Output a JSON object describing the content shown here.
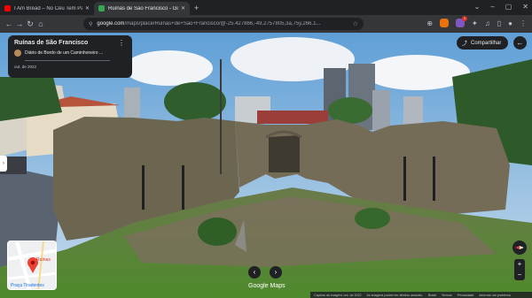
{
  "browser": {
    "tabs": [
      {
        "title": "I Am Bread – No Céu Tem Pão! - You",
        "favicon_color": "#ff0000",
        "active": false
      },
      {
        "title": "Ruínas de São Francisco - Goog",
        "favicon_color": "#34a853",
        "active": true
      }
    ],
    "new_tab_label": "+",
    "url_host": "google.com",
    "url_path": "/maps/place/Ruinas+de+São+Francisco/@-25.427866,-49.2757805,3a,75y,266.1...",
    "extension_badge": "1"
  },
  "panel": {
    "place_title": "Ruínas de São Francisco",
    "contributor": "Diário de Bordo de um Caminhoneiro ...",
    "capture_date": "out. de 2022"
  },
  "share_label": "Compartilhar",
  "minimap": {
    "place_label": "Ruínas",
    "street_label": "Praça Tiradentes"
  },
  "brand": "Google Maps",
  "footer": {
    "items": [
      "Captura da imagem: out. de 2022",
      "As imagens podem ter direitos autorais.",
      "Brasil",
      "Termos",
      "Privacidade",
      "Informar um problema"
    ]
  },
  "colors": {
    "accent": "#1a73e8",
    "pin": "#ea4335",
    "dark_ui": "#202124"
  }
}
